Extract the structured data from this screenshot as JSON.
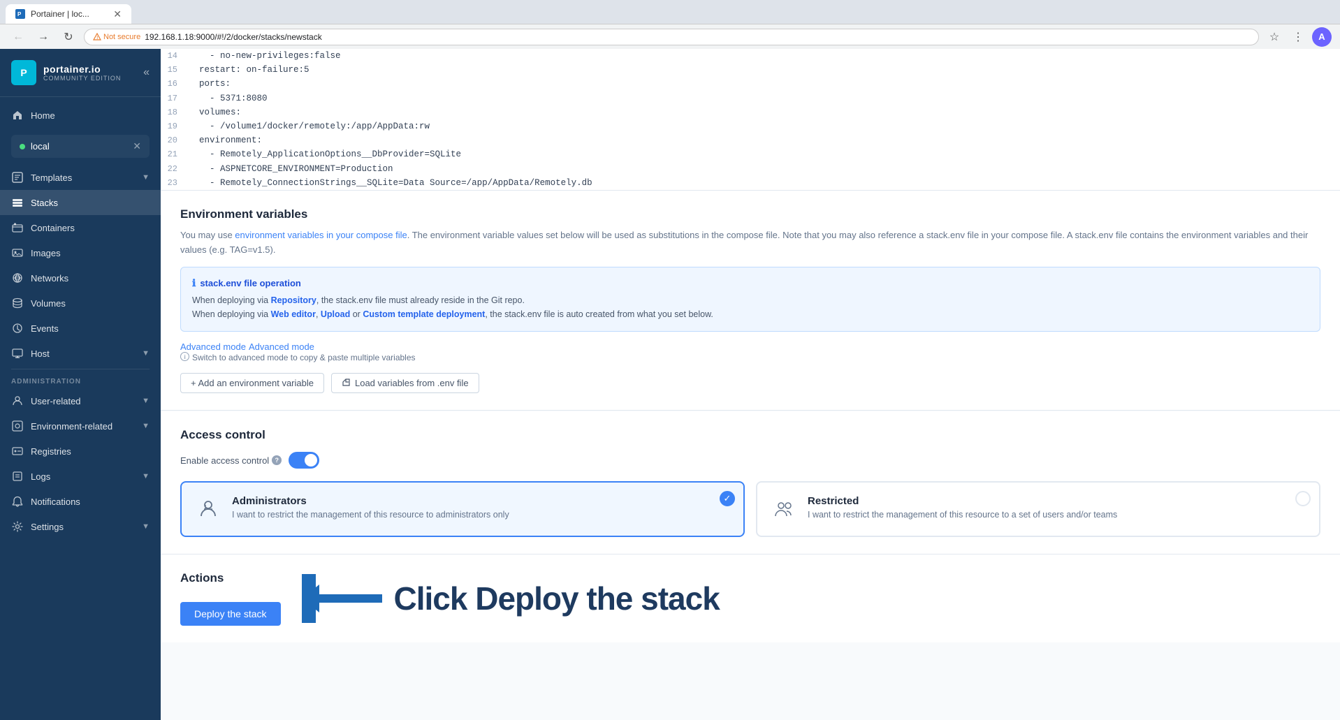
{
  "browser": {
    "tab_title": "Portainer | loc...",
    "url": "192.168.1.18:9000/#!/2/docker/stacks/newstack",
    "not_secure_label": "Not secure"
  },
  "sidebar": {
    "logo_main": "portainer.io",
    "logo_sub": "COMMUNITY EDITION",
    "collapse_icon": "«",
    "endpoint_name": "local",
    "home_label": "Home",
    "templates_label": "Templates",
    "stacks_label": "Stacks",
    "containers_label": "Containers",
    "images_label": "Images",
    "networks_label": "Networks",
    "volumes_label": "Volumes",
    "events_label": "Events",
    "host_label": "Host",
    "admin_label": "Administration",
    "user_related_label": "User-related",
    "env_related_label": "Environment-related",
    "registries_label": "Registries",
    "logs_label": "Logs",
    "notifications_label": "Notifications",
    "settings_label": "Settings"
  },
  "code_section": {
    "lines": [
      {
        "num": "14",
        "content": "    - no-new-privileges:false"
      },
      {
        "num": "15",
        "content": "  restart: on-failure:5"
      },
      {
        "num": "16",
        "content": "  ports:"
      },
      {
        "num": "17",
        "content": "    - 5371:8080"
      },
      {
        "num": "18",
        "content": "  volumes:"
      },
      {
        "num": "19",
        "content": "    - /volume1/docker/remotely:/app/AppData:rw"
      },
      {
        "num": "20",
        "content": "  environment:"
      },
      {
        "num": "21",
        "content": "    - Remotely_ApplicationOptions__DbProvider=SQLite"
      },
      {
        "num": "22",
        "content": "    - ASPNETCORE_ENVIRONMENT=Production"
      },
      {
        "num": "23",
        "content": "    - Remotely_ConnectionStrings__SQLite=Data Source=/app/AppData/Remotely.db"
      }
    ]
  },
  "env_section": {
    "title": "Environment variables",
    "desc_prefix": "You may use ",
    "desc_link": "environment variables in your compose file",
    "desc_suffix": ". The environment variable values set below will be used as substitutions in the compose file. Note that you may also reference a stack.env file in your compose file. A stack.env file contains the environment variables and their values (e.g. TAG=v1.5).",
    "info_title": "stack.env file operation",
    "info_line1_prefix": "When deploying via ",
    "info_line1_link": "Repository",
    "info_line1_suffix": ", the stack.env file must already reside in the Git repo.",
    "info_line2_prefix": "When deploying via ",
    "info_line2_link1": "Web editor",
    "info_line2_sep1": ", ",
    "info_line2_link2": "Upload",
    "info_line2_sep2": " or ",
    "info_line2_link3": "Custom template deployment",
    "info_line2_suffix": ", the stack.env file is auto created from what you set below.",
    "advanced_mode_label": "Advanced mode",
    "advanced_mode_hint": "Switch to advanced mode to copy & paste multiple variables",
    "add_env_label": "+ Add an environment variable",
    "load_vars_label": "Load variables from .env file"
  },
  "access_section": {
    "title": "Access control",
    "enable_label": "Enable access control",
    "admin_title": "Administrators",
    "admin_desc": "I want to restrict the management of this resource to administrators only",
    "restricted_title": "Restricted",
    "restricted_desc": "I want to restrict the management of this resource to a set of users and/or teams"
  },
  "actions_section": {
    "title": "Actions",
    "deploy_label": "Deploy the stack",
    "annotation_text": "Click Deploy the stack"
  }
}
